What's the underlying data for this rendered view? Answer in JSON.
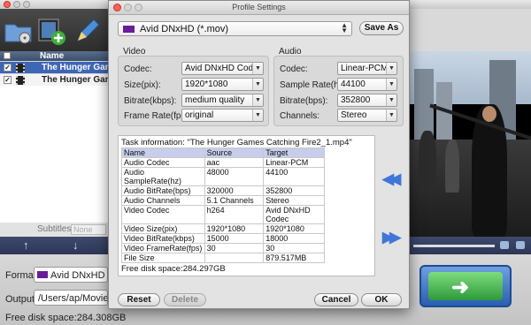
{
  "background_app": {
    "list_header": "Name",
    "files": [
      {
        "name": "The Hunger Game...",
        "selected": true,
        "checked": true
      },
      {
        "name": "The Hunger Game...",
        "selected": false,
        "checked": true
      }
    ],
    "subtitles_label": "Subtitles:",
    "subtitles_value": "None",
    "format_label": "Format:",
    "format_value": "Avid DNxHD (*.m",
    "output_label": "Output:",
    "output_value": "/Users/ap/Movies",
    "free_disk_space": "Free disk space:284.308GB"
  },
  "dialog": {
    "title": "Profile Settings",
    "profile": "Avid DNxHD (*.mov)",
    "save_as": "Save As",
    "video": {
      "group_title": "Video",
      "codec_label": "Codec:",
      "codec_value": "Avid DNxHD Code",
      "size_label": "Size(pix):",
      "size_value": "1920*1080",
      "bitrate_label": "Bitrate(kbps):",
      "bitrate_value": "medium quality",
      "framerate_label": "Frame Rate(fps):",
      "framerate_value": "original"
    },
    "audio": {
      "group_title": "Audio",
      "codec_label": "Codec:",
      "codec_value": "Linear-PCM",
      "samplerate_label": "Sample Rate(hz):",
      "samplerate_value": "44100",
      "bitrate_label": "Bitrate(bps):",
      "bitrate_value": "352800",
      "channels_label": "Channels:",
      "channels_value": "Stereo"
    },
    "task": {
      "title": "Task information: \"The Hunger Games Catching Fire2_1.mp4\"",
      "header": [
        "Name",
        "Source",
        "Target"
      ],
      "rows": [
        [
          "Audio Codec",
          "aac",
          "Linear-PCM"
        ],
        [
          "Audio SampleRate(hz)",
          "48000",
          "44100"
        ],
        [
          "Audio BitRate(bps)",
          "320000",
          "352800"
        ],
        [
          "Audio Channels",
          "5.1 Channels",
          "Stereo"
        ],
        [
          "Video Codec",
          "h264",
          "Avid DNxHD Codec"
        ],
        [
          "Video Size(pix)",
          "1920*1080",
          "1920*1080"
        ],
        [
          "Video BitRate(kbps)",
          "15000",
          "18000"
        ],
        [
          "Video FrameRate(fps)",
          "30",
          "30"
        ],
        [
          "File Size",
          "",
          "879.517MB"
        ]
      ],
      "free_disk_space": "Free disk space:284.297GB"
    },
    "buttons": {
      "reset": "Reset",
      "delete": "Delete",
      "cancel": "Cancel",
      "ok": "OK"
    }
  },
  "colors": {
    "accent_blue": "#3f76d8",
    "selection": "#3d66b4",
    "table_header": "#c7cdea"
  }
}
